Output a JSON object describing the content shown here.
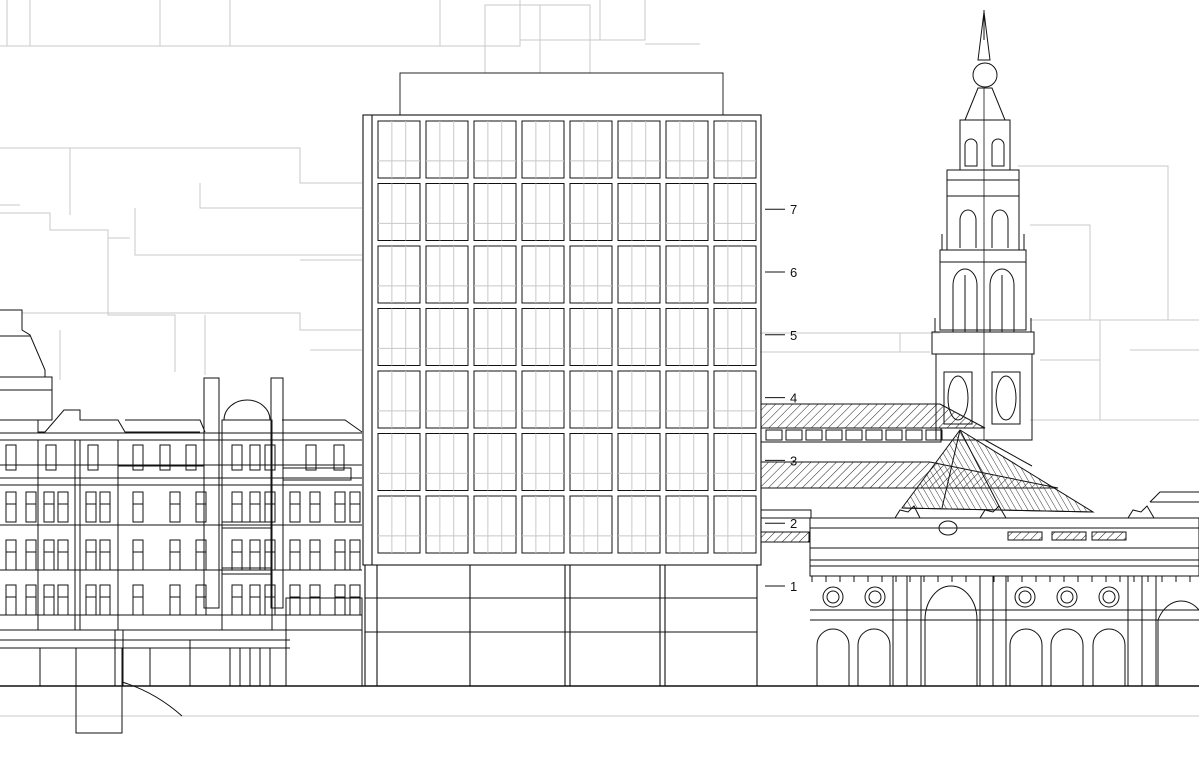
{
  "elevation": {
    "floor_labels": [
      "1",
      "2",
      "3",
      "4",
      "5",
      "6",
      "7"
    ]
  },
  "colors": {
    "line": "#111111",
    "context_line": "#c8c8c8",
    "background": "#ffffff"
  }
}
